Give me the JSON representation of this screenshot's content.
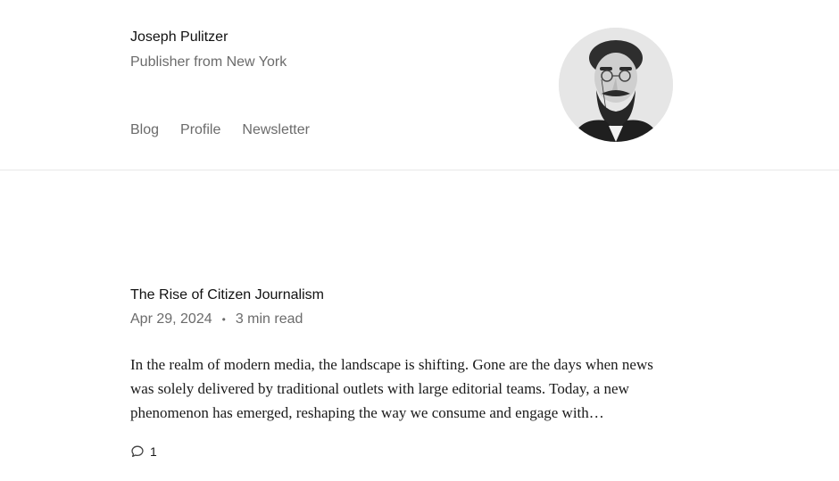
{
  "author": {
    "name": "Joseph Pulitzer",
    "bio": "Publisher from New York"
  },
  "nav": {
    "items": [
      "Blog",
      "Profile",
      "Newsletter"
    ]
  },
  "avatar": {
    "icon": "portrait-photo"
  },
  "post": {
    "title": "The Rise of Citizen Journalism",
    "date": "Apr 29, 2024",
    "separator": "•",
    "read_time": "3 min read",
    "excerpt": "In the realm of modern media, the landscape is shifting. Gone are the days when news was solely delivered by traditional outlets with large editorial teams. Today, a new phenomenon has emerged, reshaping the way we consume and engage with…",
    "comments": "1",
    "comment_icon": "speech-bubble-icon"
  }
}
